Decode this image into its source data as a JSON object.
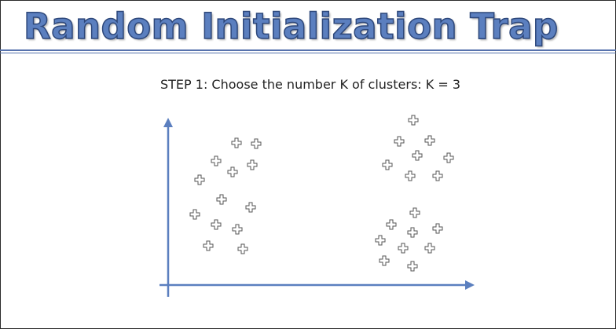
{
  "slide": {
    "title": "Random Initialization Trap",
    "step_label": "STEP 1",
    "step_text": ": Choose the number K of clusters: K = 3"
  },
  "colors": {
    "title": "#5b7fbf",
    "title_outline": "#2d477a",
    "axis": "#5b7fbf",
    "rule": "#5672ad"
  },
  "icons": {
    "point": "plus-icon"
  }
}
